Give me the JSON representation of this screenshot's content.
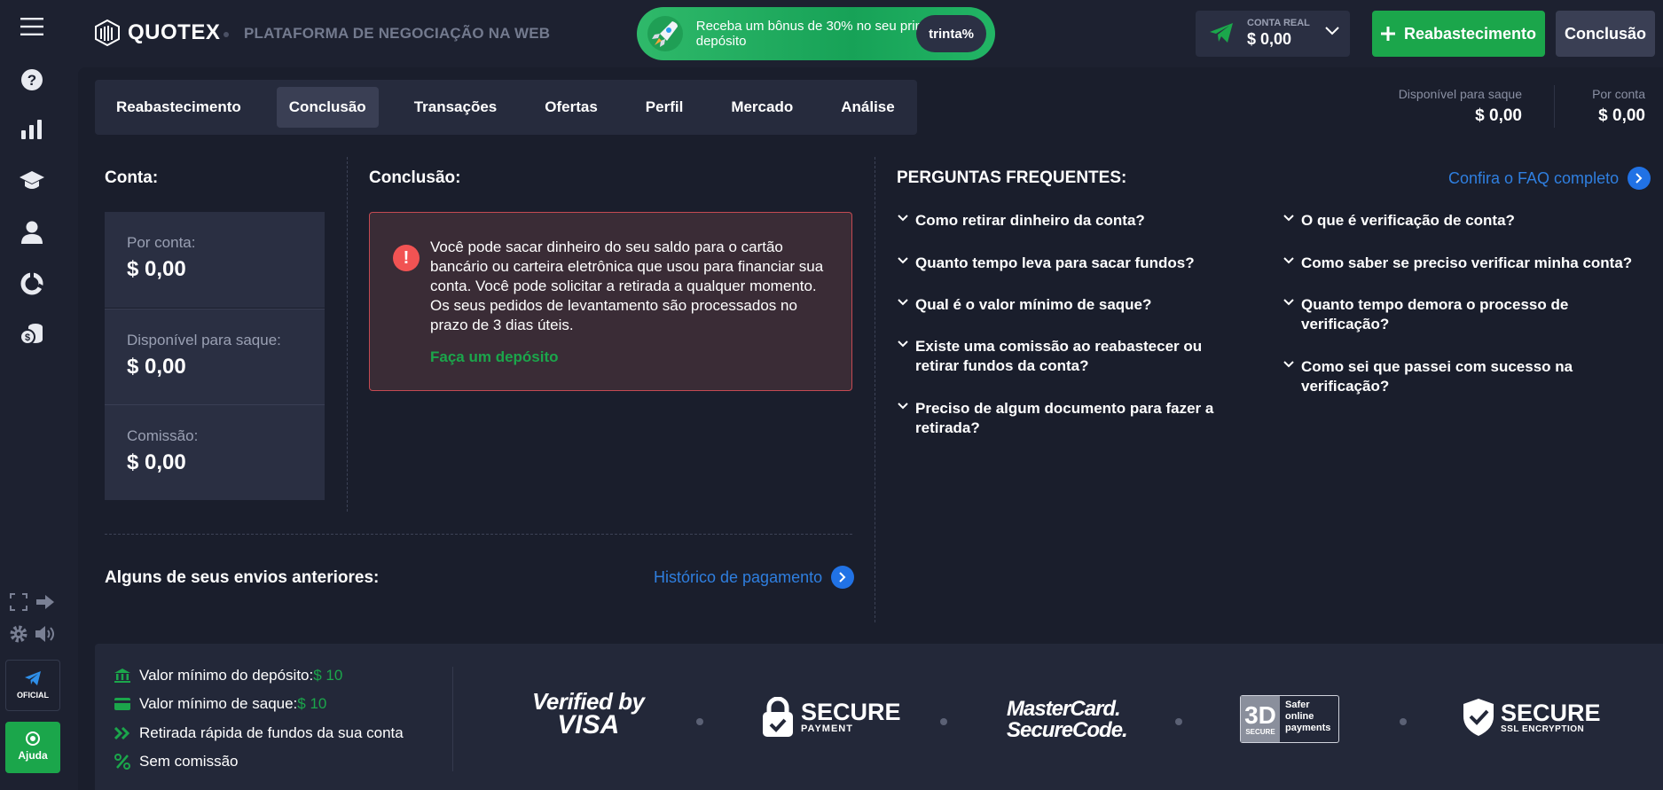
{
  "sidebar": {
    "icons": [
      "menu-icon",
      "help-icon",
      "chart-icon",
      "education-icon",
      "profile-icon",
      "market-icon",
      "coins-icon"
    ],
    "official_label": "OFICIAL",
    "help_label": "Ajuda"
  },
  "header": {
    "logo_text": "QUOTEX",
    "platform_text": "PLATAFORMA DE NEGOCIAÇÃO NA WEB",
    "promo_text": "Receba um bônus de 30% no seu primeiro depósito",
    "promo_badge": "trinta%",
    "account_label": "CONTA REAL",
    "account_value": "$ 0,00",
    "deposit_button": "Reabastecimento",
    "withdraw_button": "Conclusão"
  },
  "tabs": [
    {
      "label": "Reabastecimento",
      "active": false
    },
    {
      "label": "Conclusão",
      "active": true
    },
    {
      "label": "Transações",
      "active": false
    },
    {
      "label": "Ofertas",
      "active": false
    },
    {
      "label": "Perfil",
      "active": false
    },
    {
      "label": "Mercado",
      "active": false
    },
    {
      "label": "Análise",
      "active": false
    }
  ],
  "balances": {
    "available_label": "Disponível para saque",
    "available_value": "$ 0,00",
    "account_label": "Por conta",
    "account_value": "$ 0,00"
  },
  "account_section": {
    "title": "Conta:",
    "cards": [
      {
        "label": "Por conta:",
        "value": "$ 0,00"
      },
      {
        "label": "Disponível para saque:",
        "value": "$ 0,00"
      },
      {
        "label": "Comissão:",
        "value": "$ 0,00"
      }
    ]
  },
  "withdraw_section": {
    "title": "Conclusão:",
    "alert_text": "Você pode sacar dinheiro do seu saldo para o cartão bancário ou carteira eletrônica que usou para financiar sua conta. Você pode solicitar a retirada a qualquer momento. Os seus pedidos de levantamento são processados no prazo de 3 dias úteis.",
    "alert_link": "Faça um depósito"
  },
  "history": {
    "title": "Alguns de seus envios anteriores:",
    "link": "Histórico de pagamento"
  },
  "faq": {
    "title": "PERGUNTAS FREQUENTES:",
    "link": "Confira o FAQ completo",
    "left": [
      "Como retirar dinheiro da conta?",
      "Quanto tempo leva para sacar fundos?",
      "Qual é o valor mínimo de saque?",
      "Existe uma comissão ao reabastecer ou retirar fundos da conta?",
      "Preciso de algum documento para fazer a retirada?"
    ],
    "right": [
      "O que é verificação de conta?",
      "Como saber se preciso verificar minha conta?",
      "Quanto tempo demora o processo de verificação?",
      "Como sei que passei com sucesso na verificação?"
    ]
  },
  "footer": {
    "min_deposit_label": "Valor mínimo do depósito:",
    "min_deposit_value": "$ 10",
    "min_withdraw_label": "Valor mínimo de saque:",
    "min_withdraw_value": "$ 10",
    "fast_withdraw": "Retirada rápida de fundos da sua conta",
    "no_commission": "Sem comissão",
    "brands": {
      "visa_top": "Verified by",
      "visa_bottom": "VISA",
      "secure_payment_top": "SECURE",
      "secure_payment_bottom": "PAYMENT",
      "mastercard_top": "MasterCard.",
      "mastercard_bottom": "SecureCode.",
      "threed_big": "3D",
      "threed_small": "SECURE",
      "threed_text_1": "Safer",
      "threed_text_2": "online",
      "threed_text_3": "payments",
      "ssl_top": "SECURE",
      "ssl_bottom": "SSL ENCRYPTION"
    }
  },
  "colors": {
    "background": "#1d2130",
    "panel": "#1a1e2c",
    "card": "#2a2f42",
    "green": "#1ba64b",
    "blue": "#2f7fe0",
    "alert_border": "#c44a52"
  }
}
